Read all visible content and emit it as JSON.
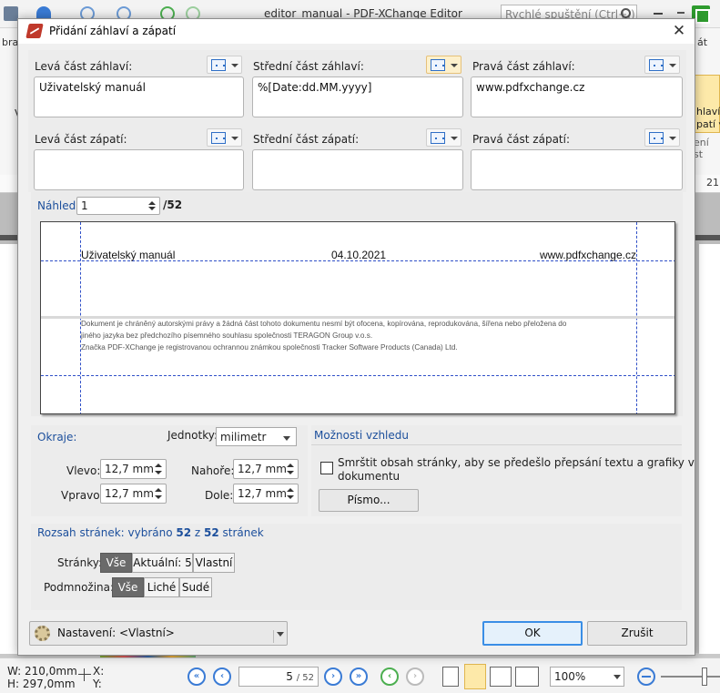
{
  "app": {
    "title": "editor_manual - PDF-XChange Editor",
    "search_placeholder": "Rychlé spuštění (Ctrl+.)",
    "ribbon_left_text": "braz",
    "ribbon_left_v": "V",
    "ribbon_right_text": "át",
    "ribbon_right_button": "hlaví\npatí ▾",
    "ribbon_right_sub": "ení st",
    "ruler_number": "21",
    "accent_color": "#2e9b2e"
  },
  "status": {
    "width": "W: 210,0mm",
    "height": "H: 297,0mm",
    "x_label": "X:",
    "y_label": "Y:",
    "page_current": "5",
    "page_total": "/ 52",
    "zoom": "100%"
  },
  "dialog": {
    "title": "Přidání záhlaví a zápatí",
    "header": {
      "left_label": "Levá část záhlaví:",
      "center_label": "Střední část záhlaví:",
      "right_label": "Pravá část záhlaví:",
      "left_value": "Uživatelský manuál",
      "center_value": "%[Date:dd.MM.yyyy]",
      "right_value": "www.pdfxchange.cz"
    },
    "footer": {
      "left_label": "Levá část zápatí:",
      "center_label": "Střední část zápatí:",
      "right_label": "Pravá část zápatí:",
      "left_value": "",
      "center_value": "",
      "right_value": ""
    },
    "preview": {
      "label": "Náhled",
      "page_value": "1",
      "page_total": "/52",
      "header_left": "Uživatelský manuál",
      "header_center": "04.10.2021",
      "header_right": "www.pdfxchange.cz",
      "body_line1": "Dokument je chráněný autorskými právy a žádná část tohoto dokumentu nesmí být ofocena, kopírována, reprodukována, šířena nebo přeložena do",
      "body_line2": "jiného jazyka bez předchozího písemného souhlasu společnosti TERAGON Group v.o.s.",
      "body_line3": "Značka PDF-XChange je registrovanou ochrannou známkou společnosti Tracker Software Products (Canada) Ltd."
    },
    "margins": {
      "title": "Okraje:",
      "units_label": "Jednotky:",
      "units_value": "milimetr",
      "left_label": "Vlevo:",
      "left_value": "12,7 mm",
      "right_label": "Vpravo:",
      "right_value": "12,7 mm",
      "top_label": "Nahoře:",
      "top_value": "12,7 mm",
      "bottom_label": "Dole:",
      "bottom_value": "12,7 mm"
    },
    "appearance": {
      "title": "Možnosti vzhledu",
      "shrink_label_line1": "Smrštit obsah stránky, aby se předešlo přepsání textu a grafiky v",
      "shrink_label_line2": "dokumentu",
      "shrink_checked": false,
      "font_button": "Písmo..."
    },
    "range": {
      "title_prefix": "Rozsah stránek: vybráno ",
      "selected": "52",
      "of": " z ",
      "total": "52",
      "title_suffix": " stránek",
      "pages_label": "Stránky:",
      "pages_options": [
        "Vše",
        "Aktuální: 5",
        "Vlastní"
      ],
      "subset_label": "Podmnožina:",
      "subset_options": [
        "Vše",
        "Liché",
        "Sudé"
      ]
    },
    "settings_label": "Nastavení:",
    "settings_value": "<Vlastní>",
    "ok": "OK",
    "cancel": "Zrušit"
  }
}
